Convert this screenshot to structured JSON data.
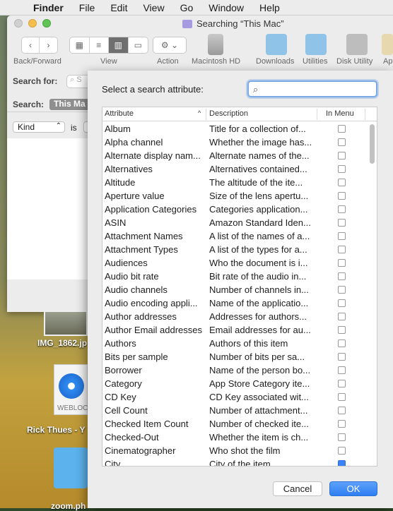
{
  "menubar": {
    "app_name": "Finder",
    "items": [
      "File",
      "Edit",
      "View",
      "Go",
      "Window",
      "Help"
    ]
  },
  "window": {
    "title": "Searching “This Mac”",
    "toolbar": {
      "back_forward_label": "Back/Forward",
      "view_label": "View",
      "action_label": "Action",
      "macintosh_hd_label": "Macintosh HD",
      "downloads_label": "Downloads",
      "utilities_label": "Utilities",
      "disk_utility_label": "Disk Utility",
      "cut_label": "Ap"
    },
    "search": {
      "search_for_label": "Search for:",
      "search_field_placeholder": "S",
      "search_scope_label": "Search:",
      "scope_value": "This Ma",
      "kind_value": "Kind",
      "is_label": "is"
    }
  },
  "desktop": {
    "icon1_label": "IMG_1862.jp",
    "icon2_label": "WEBLOC",
    "icon3_label": "Rick Thues - Y",
    "icon4_label": "zoom.ph"
  },
  "sheet": {
    "prompt": "Select a search attribute:",
    "search_value": "",
    "columns": {
      "attribute": "Attribute",
      "description": "Description",
      "in_menu": "In Menu"
    },
    "rows": [
      {
        "attribute": "Album",
        "description": "Title for a collection of...",
        "in_menu": false
      },
      {
        "attribute": "Alpha channel",
        "description": "Whether the image has...",
        "in_menu": false
      },
      {
        "attribute": "Alternate display nam...",
        "description": "Alternate names of the...",
        "in_menu": false
      },
      {
        "attribute": "Alternatives",
        "description": "Alternatives contained...",
        "in_menu": false
      },
      {
        "attribute": "Altitude",
        "description": "The altitude of the ite...",
        "in_menu": false
      },
      {
        "attribute": "Aperture value",
        "description": "Size of the lens apertu...",
        "in_menu": false
      },
      {
        "attribute": "Application Categories",
        "description": "Categories application...",
        "in_menu": false
      },
      {
        "attribute": "ASIN",
        "description": "Amazon Standard Iden...",
        "in_menu": false
      },
      {
        "attribute": "Attachment Names",
        "description": "A list of the names of a...",
        "in_menu": false
      },
      {
        "attribute": "Attachment Types",
        "description": "A list of the types for a...",
        "in_menu": false
      },
      {
        "attribute": "Audiences",
        "description": "Who the document is i...",
        "in_menu": false
      },
      {
        "attribute": "Audio bit rate",
        "description": "Bit rate of the audio in...",
        "in_menu": false
      },
      {
        "attribute": "Audio channels",
        "description": "Number of channels in...",
        "in_menu": false
      },
      {
        "attribute": "Audio encoding appli...",
        "description": "Name of the applicatio...",
        "in_menu": false
      },
      {
        "attribute": "Author addresses",
        "description": "Addresses for authors...",
        "in_menu": false
      },
      {
        "attribute": "Author Email addresses",
        "description": "Email addresses for au...",
        "in_menu": false
      },
      {
        "attribute": "Authors",
        "description": "Authors of this item",
        "in_menu": false
      },
      {
        "attribute": "Bits per sample",
        "description": "Number of bits per sa...",
        "in_menu": false
      },
      {
        "attribute": "Borrower",
        "description": "Name of the person bo...",
        "in_menu": false
      },
      {
        "attribute": "Category",
        "description": "App Store Category ite...",
        "in_menu": false
      },
      {
        "attribute": "CD Key",
        "description": "CD Key associated wit...",
        "in_menu": false
      },
      {
        "attribute": "Cell Count",
        "description": "Number of attachment...",
        "in_menu": false
      },
      {
        "attribute": "Checked Item Count",
        "description": "Number of checked ite...",
        "in_menu": false
      },
      {
        "attribute": "Checked-Out",
        "description": "Whether the item is ch...",
        "in_menu": false
      },
      {
        "attribute": "Cinematographer",
        "description": "Who shot the film",
        "in_menu": false
      },
      {
        "attribute": "City",
        "description": "City of the item",
        "in_menu": true
      }
    ],
    "cancel_label": "Cancel",
    "ok_label": "OK"
  },
  "colors": {
    "accent": "#3b82f7",
    "selected_segment": "#6f6f6f"
  }
}
